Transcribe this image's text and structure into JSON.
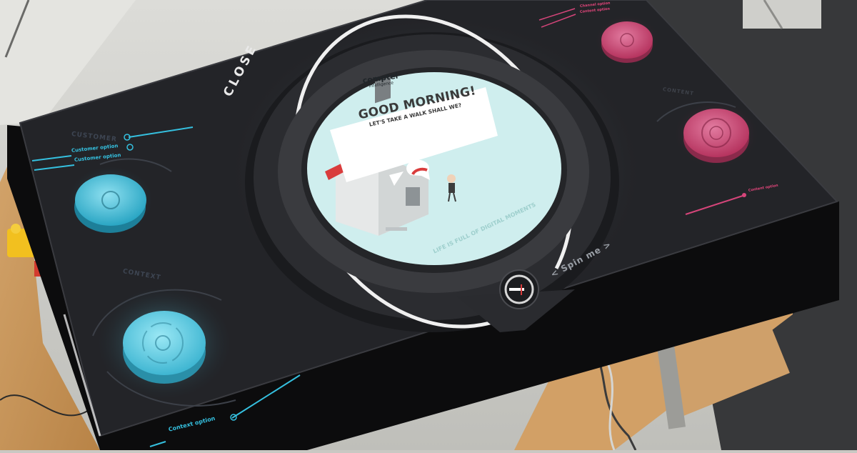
{
  "close_label": "CLOSE",
  "sections": {
    "customer": {
      "title": "CUSTOMER",
      "options": [
        "Customer option",
        "Customer option"
      ],
      "color": "#35c0df"
    },
    "context": {
      "title": "CONTEXT",
      "options": [
        "Context option"
      ],
      "color": "#35c0df"
    },
    "content": {
      "title": "CONTENT",
      "options": [
        "Channel option",
        "Content option",
        "Content option"
      ],
      "color": "#d6457a"
    }
  },
  "center_screen": {
    "brand_name": "comptel",
    "brand_sub": "Intelligence",
    "greeting_title": "GOOD MORNING!",
    "greeting_subtitle": "LET'S TAKE A WALK SHALL WE?",
    "tagline": "LIFE IS FULL OF DIGITAL MOMENTS",
    "background_color": "#cfeeee"
  },
  "spin_label": "< Spin me >",
  "icons": {
    "token": "comptel-token-icon",
    "check": "check-circle-icon",
    "knob": "rotary-knob-icon"
  }
}
